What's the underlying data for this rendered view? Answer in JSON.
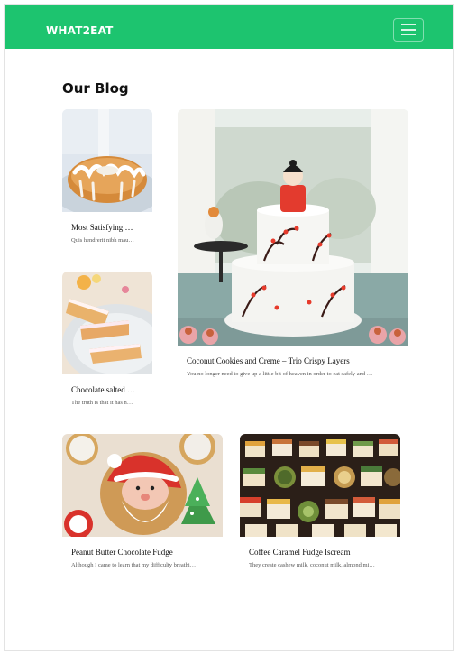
{
  "navbar": {
    "brand": "WHAT2EAT",
    "menu_icon": "hamburger-menu-icon",
    "color": "#1dc46f"
  },
  "page": {
    "title": "Our Blog"
  },
  "posts": [
    {
      "title": "Most Satisfying …",
      "excerpt": "Quis hendrerit nibh mau…",
      "image": "bundt-cake-photo"
    },
    {
      "title": "Chocolate salted …",
      "excerpt": "The truth is that it has n…",
      "image": "cake-slices-photo"
    },
    {
      "title": "Coconut Cookies and Creme – Trio Crispy Layers",
      "excerpt": "You no longer need to give up a little bit of heaven in order to eat safely and …",
      "image": "decorated-wedding-cake-photo"
    },
    {
      "title": "Peanut Butter Chocolate Fudge",
      "excerpt": "Although I came to learn that my difficulty breathi…",
      "image": "christmas-cookies-photo"
    },
    {
      "title": "Coffee Caramel Fudge Iscream",
      "excerpt": "They create cashew milk, coconut milk, almond mi…",
      "image": "petit-fours-photo"
    }
  ]
}
